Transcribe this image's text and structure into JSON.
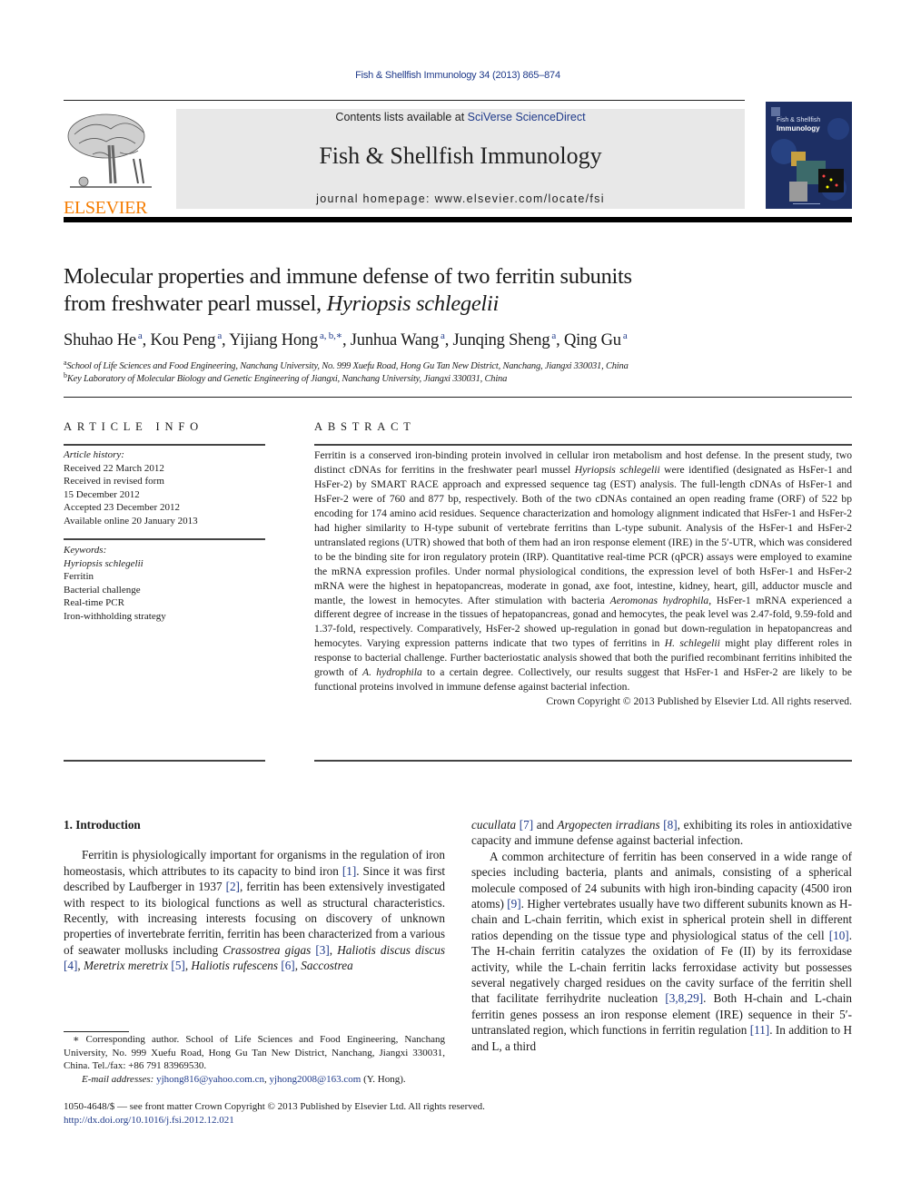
{
  "journal_ref": "Fish & Shellfish Immunology 34 (2013) 865–874",
  "banner": {
    "contents_prefix": "Contents lists available at ",
    "contents_link": "SciVerse ScienceDirect",
    "journal_title": "Fish & Shellfish Immunology",
    "homepage_label": "journal homepage: ",
    "homepage_url": "www.elsevier.com/locate/fsi"
  },
  "publisher": {
    "wordmark": "ELSEVIER"
  },
  "cover": {
    "line1": "Fish & Shellfish",
    "line2": "Immunology"
  },
  "article": {
    "title_line1": "Molecular properties and immune defense of two ferritin subunits",
    "title_line2_plain": "from freshwater pearl mussel, ",
    "title_line2_italic": "Hyriopsis schlegelii",
    "authors": [
      {
        "name": "Shuhao He",
        "sup": "a"
      },
      {
        "name": "Kou Peng",
        "sup": "a"
      },
      {
        "name": "Yijiang Hong",
        "sup": "a, b,∗"
      },
      {
        "name": "Junhua Wang",
        "sup": "a"
      },
      {
        "name": "Junqing Sheng",
        "sup": "a"
      },
      {
        "name": "Qing Gu",
        "sup": "a"
      }
    ],
    "affiliations": [
      {
        "mark": "a",
        "text": "School of Life Sciences and Food Engineering, Nanchang University, No. 999 Xuefu Road, Hong Gu Tan New District, Nanchang, Jiangxi 330031, China"
      },
      {
        "mark": "b",
        "text": "Key Laboratory of Molecular Biology and Genetic Engineering of Jiangxi, Nanchang University, Jiangxi 330031, China"
      }
    ]
  },
  "article_info": {
    "heading": "ARTICLE INFO",
    "history_label": "Article history:",
    "history": [
      "Received 22 March 2012",
      "Received in revised form",
      "15 December 2012",
      "Accepted 23 December 2012",
      "Available online 20 January 2013"
    ],
    "keywords_label": "Keywords:",
    "keywords": [
      "Hyriopsis schlegelii",
      "Ferritin",
      "Bacterial challenge",
      "Real-time PCR",
      "Iron-withholding strategy"
    ]
  },
  "abstract": {
    "heading": "ABSTRACT",
    "p1": "Ferritin is a conserved iron-binding protein involved in cellular iron metabolism and host defense. In the present study, two distinct cDNAs for ferritins in the freshwater pearl mussel ",
    "i1": "Hyriopsis schlegelii",
    "p2": " were identified (designated as HsFer-1 and HsFer-2) by SMART RACE approach and expressed sequence tag (EST) analysis. The full-length cDNAs of HsFer-1 and HsFer-2 were of 760 and 877 bp, respectively. Both of the two cDNAs contained an open reading frame (ORF) of 522 bp encoding for 174 amino acid residues. Sequence characterization and homology alignment indicated that HsFer-1 and HsFer-2 had higher similarity to H-type subunit of vertebrate ferritins than L-type subunit. Analysis of the HsFer-1 and HsFer-2 untranslated regions (UTR) showed that both of them had an iron response element (IRE) in the 5′-UTR, which was considered to be the binding site for iron regulatory protein (IRP). Quantitative real-time PCR (qPCR) assays were employed to examine the mRNA expression profiles. Under normal physiological conditions, the expression level of both HsFer-1 and HsFer-2 mRNA were the highest in hepatopancreas, moderate in gonad, axe foot, intestine, kidney, heart, gill, adductor muscle and mantle, the lowest in hemocytes. After stimulation with bacteria ",
    "i2": "Aeromonas hydrophila",
    "p3": ", HsFer-1 mRNA experi­enced a different degree of increase in the tissues of hepatopancreas, gonad and hemocytes, the peak level was 2.47-fold, 9.59-fold and 1.37-fold, respectively. Comparatively, HsFer-2 showed up-regulation in gonad but down-regulation in hepatopancreas and hemocytes. Varying expression patterns indicate that two types of ferritins in ",
    "i3": "H. schlegelii",
    "p4": " might play different roles in response to bacterial challenge. Further bacteriostatic analysis showed that both the purified recombinant ferritins inhibited the growth of ",
    "i4": "A. hydrophila",
    "p5": " to a certain degree. Collectively, our results suggest that HsFer-1 and HsFer-2 are likely to be functional proteins involved in immune defense against bacterial infection.",
    "copyright": "Crown Copyright © 2013 Published by Elsevier Ltd. All rights reserved."
  },
  "introduction": {
    "heading": "1.  Introduction",
    "left": {
      "t1": "Ferritin is physiologically important for organisms in the regu­lation of iron homeostasis, which attributes to its capacity to bind iron ",
      "r1": "[1]",
      "t2": ". Since it was first described by Laufberger in 1937 ",
      "r2": "[2]",
      "t3": ", fer­ritin has been extensively investigated with respect to its biological functions as well as structural characteristics. Recently, with increasing interests focusing on discovery of unknown properties of invertebrate ferritin, ferritin has been characterized from a various of seawater mollusks including ",
      "s1": "Crassostrea gigas",
      "r3": "[3]",
      "s2": "Haliotis discus discus",
      "r4": "[4]",
      "s3": "Meretrix meretrix",
      "r5": "[5]",
      "s4": "Haliotis rufescens",
      "r6": "[6]",
      "s5": "Saccostrea"
    },
    "right": {
      "s6": "cucullata",
      "r7": "[7]",
      "t_and": " and ",
      "s7": "Argopecten irradians",
      "r8": "[8]",
      "t4": ", exhibiting its roles in antioxidative capacity and immune defense against bacterial infection.",
      "t5": "A common architecture of ferritin has been conserved in a wide range of species including bacteria, plants and animals, consisting of a spherical molecule composed of 24 subunits with high iron-binding capacity (4500 iron atoms) ",
      "r9": "[9]",
      "t6": ". Higher vertebrates usually have two different subunits known as H-chain and L-chain ferritin, which exist in spherical protein shell in different ratios depending on the tissue type and physiological status of the cell ",
      "r10": "[10]",
      "t7": ". The H-chain ferritin catalyzes the oxidation of Fe (II) by its ferroxidase activity, while the L-chain ferritin lacks ferroxidase activity but possesses several negatively charged residues on the cavity surface of the ferritin shell that facilitate ferrihydrite nucleation ",
      "r11": "[3,8,29]",
      "t8": ". Both H-chain and L-chain ferritin genes possess an iron response element (IRE) sequence in their 5′-untranslated region, which functions in ferritin regulation ",
      "r12": "[11]",
      "t9": ". In addition to H and L, a third"
    }
  },
  "footnote": {
    "corresponding": "∗ Corresponding author. School of Life Sciences and Food Engineering, Nanchang University, No. 999 Xuefu Road, Hong Gu Tan New District, Nanchang, Jiangxi 330031, China. Tel./fax: +86 791 83969530.",
    "email_label": "E-mail addresses:",
    "email1": "yjhong816@yahoo.com.cn",
    "email2": "yjhong2008@163.com",
    "email_owner": " (Y. Hong)."
  },
  "front_matter": {
    "issn_line": "1050-4648/$ — see front matter Crown Copyright © 2013 Published by Elsevier Ltd. All rights reserved.",
    "doi": "http://dx.doi.org/10.1016/j.fsi.2012.12.021"
  },
  "colors": {
    "link": "#1f3a8a",
    "elsevier_orange": "#f57c00",
    "banner_bg": "#e8e8e8",
    "cover_bg": "#1d2f64"
  }
}
